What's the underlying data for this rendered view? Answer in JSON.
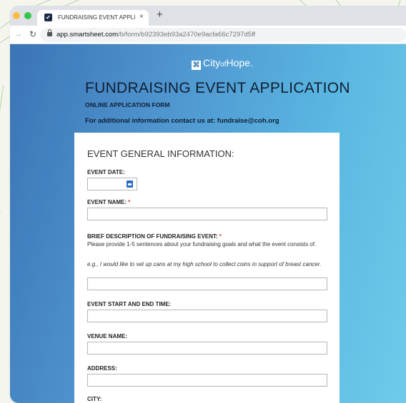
{
  "browser": {
    "tab_title": "FUNDRAISING EVENT APPLIC",
    "tab_close": "×",
    "new_tab": "+",
    "url_host": "app.smartsheet.com",
    "url_path": "/b/form/b92393eb93a2470e9acfa66c7297d5ff"
  },
  "header": {
    "logo_city": "City",
    "logo_of": "of",
    "logo_hope": "Hope.",
    "title": "FUNDRAISING EVENT APPLICATION",
    "subtitle": "ONLINE APPLICATION FORM",
    "contact": "For additional information contact us at: fundraise@coh.org"
  },
  "form": {
    "section_title": "EVENT GENERAL INFORMATION:",
    "required_marker": "*",
    "event_date_label": "EVENT DATE:",
    "event_name_label": "EVENT NAME:",
    "description_label": "BRIEF DESCRIPTION OF FUNDRAISING EVENT:",
    "description_help": "Please provide 1-5 sentences about your fundraising goals and what the event consists of.",
    "description_example": "e.g., I would like to set up cans at my high school to collect coins in support of breast cancer.",
    "time_label": "EVENT START AND END TIME:",
    "venue_label": "VENUE NAME:",
    "address_label": "ADDRESS:",
    "city_label": "CITY:"
  }
}
